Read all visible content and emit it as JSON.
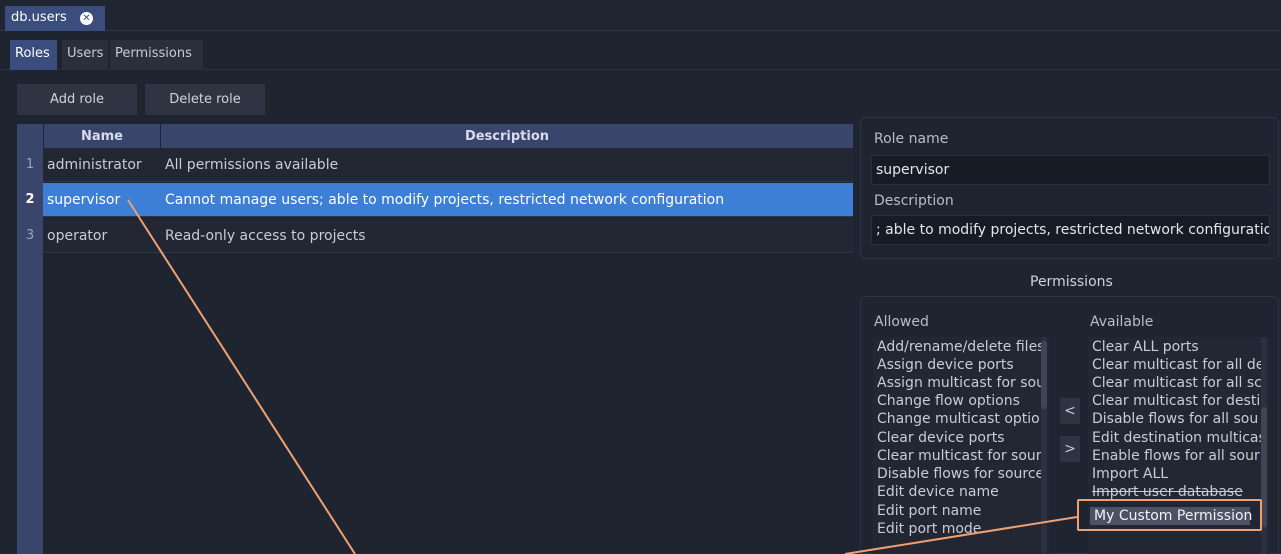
{
  "document_tab": {
    "label": "db.users",
    "close_icon": "close-icon"
  },
  "subtabs": [
    {
      "label": "Roles"
    },
    {
      "label": "Users"
    },
    {
      "label": "Permissions"
    }
  ],
  "toolbar": {
    "add_role": "Add role",
    "delete_role": "Delete role"
  },
  "roles_table": {
    "columns": [
      "Name",
      "Description"
    ],
    "rows": [
      {
        "num": "1",
        "name": "administrator",
        "description": "All permissions available",
        "selected": false
      },
      {
        "num": "2",
        "name": "supervisor",
        "description": "Cannot manage users; able to modify projects, restricted network configuration",
        "selected": true
      },
      {
        "num": "3",
        "name": "operator",
        "description": "Read-only access to projects",
        "selected": false
      }
    ]
  },
  "role_details": {
    "name_label": "Role name",
    "name_value": "supervisor",
    "description_label": "Description",
    "description_value": "; able to modify projects, restricted network configuration"
  },
  "permissions": {
    "title": "Permissions",
    "allowed_label": "Allowed",
    "available_label": "Available",
    "allowed": [
      "Add/rename/delete files",
      "Assign device ports",
      "Assign multicast for sou",
      "Change flow options",
      "Change multicast optior",
      "Clear device ports",
      "Clear multicast for sour",
      "Disable flows for source",
      "Edit device name",
      "Edit port name",
      "Edit port mode"
    ],
    "available": [
      "Clear ALL ports",
      "Clear multicast for all de",
      "Clear multicast for all sc",
      "Clear multicast for desti",
      "Disable flows for all sou",
      "Edit destination multicas",
      "Enable flows for all sour",
      "Import ALL",
      "Import user database",
      "My Custom Permission"
    ],
    "move_left": "<",
    "move_right": ">"
  },
  "colors": {
    "accent": "#3d7ed6",
    "tab": "#3a4d7c",
    "annotation": "#f0a070"
  }
}
